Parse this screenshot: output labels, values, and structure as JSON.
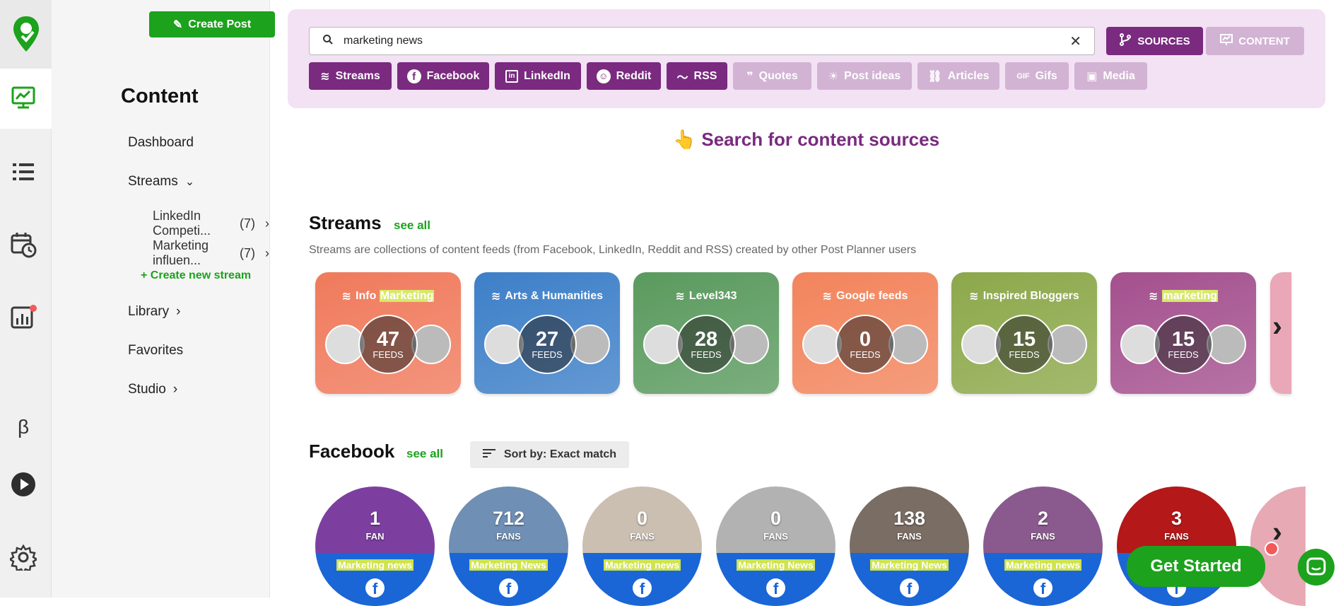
{
  "sidebar": {
    "create_post": "Create Post",
    "title": "Content",
    "dashboard": "Dashboard",
    "streams": "Streams",
    "stream_items": [
      {
        "label": "LinkedIn Competi...",
        "count": "(7)"
      },
      {
        "label": "Marketing influen...",
        "count": "(7)"
      }
    ],
    "create_stream": "+ Create new stream",
    "library": "Library",
    "favorites": "Favorites",
    "studio": "Studio"
  },
  "search": {
    "value": "marketing news",
    "sources_label": "SOURCES",
    "content_label": "CONTENT",
    "chips": [
      {
        "label": "Streams",
        "active": true
      },
      {
        "label": "Facebook",
        "active": true
      },
      {
        "label": "LinkedIn",
        "active": true
      },
      {
        "label": "Reddit",
        "active": true
      },
      {
        "label": "RSS",
        "active": true
      },
      {
        "label": "Quotes",
        "active": false
      },
      {
        "label": "Post ideas",
        "active": false
      },
      {
        "label": "Articles",
        "active": false
      },
      {
        "label": "Gifs",
        "active": false
      },
      {
        "label": "Media",
        "active": false
      }
    ]
  },
  "hint": {
    "emoji": "👆",
    "text": "Search for content sources"
  },
  "streams_section": {
    "title": "Streams",
    "see_all": "see all",
    "description": "Streams are collections of content feeds (from Facebook, LinkedIn, Reddit and RSS) created by other Post Planner users",
    "cards": [
      {
        "title_pre": "Info ",
        "title_hl": "Marketing",
        "count": "47",
        "unit": "FEEDS",
        "color": "#f07a5c"
      },
      {
        "title_pre": "Arts & Humanities",
        "title_hl": "",
        "count": "27",
        "unit": "FEEDS",
        "color": "#3d7fc8"
      },
      {
        "title_pre": "Level343",
        "title_hl": "",
        "count": "28",
        "unit": "FEEDS",
        "color": "#5a9a5e"
      },
      {
        "title_pre": "Google feeds",
        "title_hl": "",
        "count": "0",
        "unit": "FEEDS",
        "color": "#f2845c"
      },
      {
        "title_pre": "Inspired Bloggers",
        "title_hl": "",
        "count": "15",
        "unit": "FEEDS",
        "color": "#8ca84a"
      },
      {
        "title_pre": "",
        "title_hl": "marketing",
        "count": "15",
        "unit": "FEEDS",
        "color": "#a4508e"
      }
    ]
  },
  "facebook_section": {
    "title": "Facebook",
    "see_all": "see all",
    "sort_label": "Sort by: Exact match",
    "pages": [
      {
        "count": "1",
        "unit": "FAN",
        "name": "Marketing news",
        "color": "#7c3fa0"
      },
      {
        "count": "712",
        "unit": "FANS",
        "name": "Marketing News",
        "color": "#6f8fb4"
      },
      {
        "count": "0",
        "unit": "FANS",
        "name": "Marketing news",
        "color": "#cbbfb2"
      },
      {
        "count": "0",
        "unit": "FANS",
        "name": "Marketing News",
        "color": "#b2b2b2"
      },
      {
        "count": "138",
        "unit": "FANS",
        "name": "Marketing News",
        "color": "#7a6d64"
      },
      {
        "count": "2",
        "unit": "FANS",
        "name": "Marketing news",
        "color": "#8a5a8e"
      },
      {
        "count": "3",
        "unit": "FANS",
        "name": "",
        "color": "#b41818"
      }
    ]
  },
  "cta": {
    "label": "Get Started"
  },
  "colors": {
    "brand_green": "#1ca21c",
    "purple": "#7a2a7f",
    "purple_light": "#d2b3d4",
    "panel": "#f3e1f4"
  }
}
